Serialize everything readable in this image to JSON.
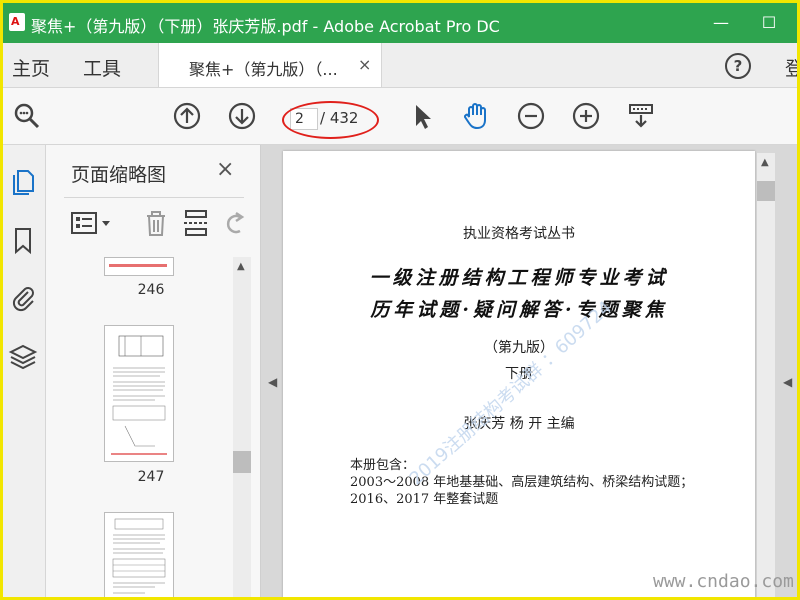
{
  "window": {
    "title": "聚焦+（第九版）（下册）张庆芳版.pdf - Adobe Acrobat Pro DC",
    "minimize": "—",
    "maximize": "☐"
  },
  "menu": {
    "home": "主页",
    "tools": "工具",
    "tab_label": "聚焦+（第九版）（...",
    "tab_close": "×",
    "help": "?",
    "signin": "登"
  },
  "toolbar": {
    "current_page": "2",
    "total_pages": "/ 432"
  },
  "thumbnails": {
    "title": "页面缩略图",
    "close": "×",
    "pages": [
      "246",
      "247"
    ]
  },
  "document": {
    "series": "执业资格考试丛书",
    "title_line1": "一级注册结构工程师专业考试",
    "title_line2": "历年试题·疑问解答·专题聚焦",
    "edition": "（第九版）",
    "volume": "下册",
    "authors": "张庆芳    杨  开    主编",
    "contents_label": "本册包含：",
    "contents_line1": "2003～2008 年地基基础、高层建筑结构、桥梁结构试题；",
    "contents_line2": "2016、2017 年整套试题",
    "watermark": "2019注册结构考试群 ：609724"
  },
  "site_watermark": "www.cndao.com",
  "colors": {
    "titlebar": "#2ea44f",
    "highlight": "#e0201b",
    "accent": "#1a73c8"
  }
}
